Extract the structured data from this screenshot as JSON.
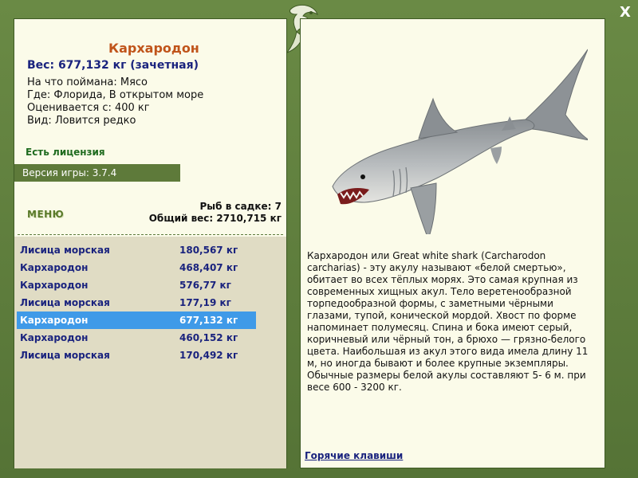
{
  "close_glyph": "X",
  "catch": {
    "name": "Кархародон",
    "weight": "Вес: 677,132 кг (зачетная)",
    "caught_on": "На что поймана: Мясо",
    "location": "Где: Флорида, В открытом море",
    "valued_from": "Оценивается с: 400 кг",
    "species_rarity": "Вид: Ловится редко"
  },
  "license": "Есть лицензия",
  "version": "Версия игры: 3.7.4",
  "menu_label": "МЕНЮ",
  "cage": {
    "count": "Рыб в садке: 7",
    "total_weight": "Общий вес: 2710,715 кг"
  },
  "fish_list": [
    {
      "name": "Лисица морская",
      "weight": "180,567 кг"
    },
    {
      "name": "Кархародон",
      "weight": "468,407 кг"
    },
    {
      "name": "Кархародон",
      "weight": "576,77 кг"
    },
    {
      "name": "Лисица морская",
      "weight": "177,19 кг"
    },
    {
      "name": "Кархародон",
      "weight": "677,132 кг"
    },
    {
      "name": "Кархародон",
      "weight": "460,152 кг"
    },
    {
      "name": "Лисица морская",
      "weight": "170,492 кг"
    }
  ],
  "selected_row": 4,
  "description": "Кархародон или Great white shark (Carcharodon carcharias) - эту акулу называют «белой смертью», обитает во всех тёплых морях. Это самая крупная из современных хищных акул. Тело веретенообразной торпедообразной формы, с заметными чёрными глазами, тупой, конической мордой. Хвост по форме напоминает полумесяц. Спина и бока имеют серый, коричневый или чёрный тон, а брюхо — грязно-белого цвета. Наибольшая из акул этого вида имела длину 11 м, но иногда бывают и более крупные экземпляры. Обычные размеры белой акулы составляют 5- 6 м. при весе 600 - 3200 кг.",
  "hotkeys_link": "Горячие клавиши",
  "colors": {
    "frame": "#5c7a3c",
    "panel": "#fbfbe9",
    "fish_name": "#c0541a",
    "text_blue": "#1a237e",
    "selection": "#3f9ae8"
  }
}
